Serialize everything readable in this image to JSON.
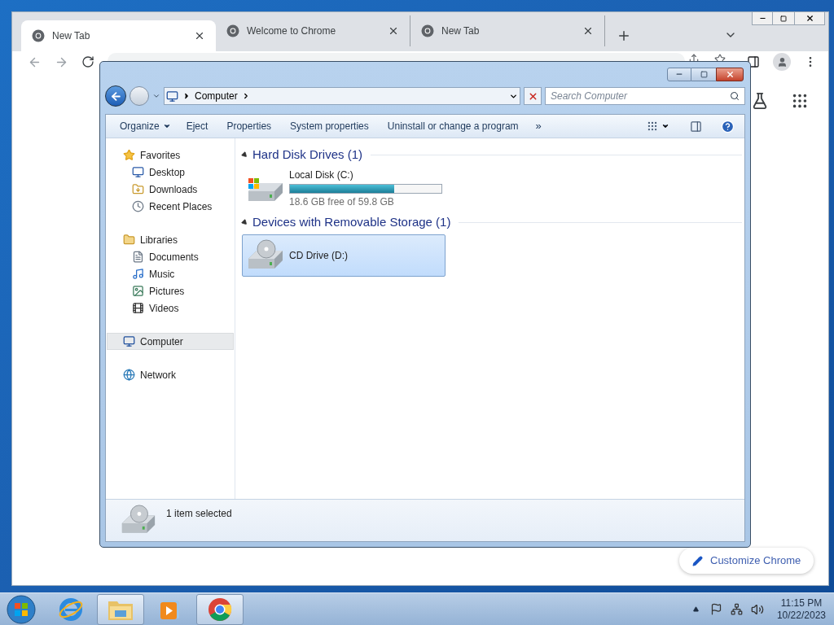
{
  "chrome": {
    "tabs": [
      {
        "title": "New Tab",
        "selected": true
      },
      {
        "title": "Welcome to Chrome",
        "selected": false
      },
      {
        "title": "New Tab",
        "selected": false
      }
    ],
    "customize_button": "Customize Chrome"
  },
  "explorer": {
    "breadcrumb": [
      "Computer"
    ],
    "search": {
      "placeholder": "Search Computer"
    },
    "toolbar": [
      {
        "label": "Organize",
        "kind": "menu"
      },
      {
        "label": "Eject",
        "kind": "action"
      },
      {
        "label": "Properties",
        "kind": "action"
      },
      {
        "label": "System properties",
        "kind": "action"
      },
      {
        "label": "Uninstall or change a program",
        "kind": "action"
      },
      {
        "label": "»",
        "kind": "overflow"
      }
    ],
    "sidebar": [
      {
        "label": "Favorites",
        "kind": "favorites",
        "selected": false,
        "children": [
          {
            "label": "Desktop",
            "kind": "desktop",
            "selected": false
          },
          {
            "label": "Downloads",
            "kind": "downloads",
            "selected": false
          },
          {
            "label": "Recent Places",
            "kind": "recent",
            "selected": false
          }
        ]
      },
      {
        "label": "Libraries",
        "kind": "libraries",
        "selected": false,
        "children": [
          {
            "label": "Documents",
            "kind": "documents",
            "selected": false
          },
          {
            "label": "Music",
            "kind": "music",
            "selected": false
          },
          {
            "label": "Pictures",
            "kind": "pictures",
            "selected": false
          },
          {
            "label": "Videos",
            "kind": "videos",
            "selected": false
          }
        ]
      },
      {
        "label": "Computer",
        "kind": "computer",
        "selected": true
      },
      {
        "label": "Network",
        "kind": "network",
        "selected": false
      }
    ],
    "sections": [
      {
        "title": "Hard Disk Drives (1)",
        "expanded": true,
        "items": [
          {
            "name": "Local Disk (C:)",
            "kind": "disk",
            "level": 0.69,
            "detail": "18.6 GB free of 59.8 GB",
            "selected": false
          }
        ]
      },
      {
        "title": "Devices with Removable Storage (1)",
        "expanded": true,
        "items": [
          {
            "name": "CD Drive (D:)",
            "kind": "cd",
            "selected": true
          }
        ]
      }
    ],
    "status": "1 item selected"
  },
  "taskbar": {
    "apps": [
      {
        "kind": "ie",
        "active": false
      },
      {
        "kind": "explorer",
        "active": true
      },
      {
        "kind": "media",
        "active": false
      },
      {
        "kind": "chrome",
        "active": true
      }
    ],
    "time": "11:15 PM",
    "date": "10/22/2023"
  }
}
